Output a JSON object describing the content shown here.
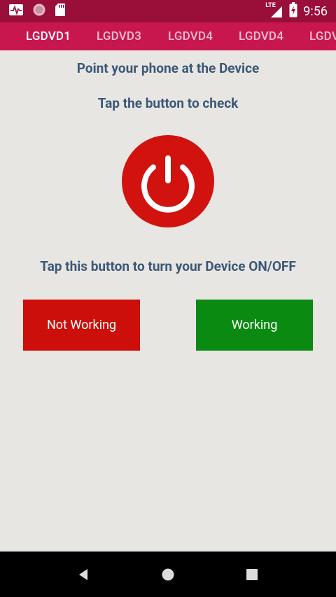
{
  "status_bar": {
    "time": "9:56",
    "network": "LTE",
    "icons": [
      "activity-icon",
      "record-icon",
      "sd-card-icon",
      "signal-icon",
      "battery-charging-icon"
    ]
  },
  "tabs": [
    {
      "label": "LGDVD1",
      "active": true
    },
    {
      "label": "LGDVD3",
      "active": false
    },
    {
      "label": "LGDVD4",
      "active": false
    },
    {
      "label": "LGDVD4",
      "active": false
    },
    {
      "label": "LGDVD",
      "active": false
    }
  ],
  "main": {
    "instruction_point": "Point your phone at the Device",
    "instruction_tap": "Tap the button to check",
    "power_icon": "power-icon",
    "instruction_toggle": "Tap this button to turn your Device ON/OFF",
    "not_working_label": "Not Working",
    "working_label": "Working"
  },
  "colors": {
    "status_bar": "#9a0e3a",
    "tab_bar": "#c8174f",
    "background": "#e8e6e3",
    "heading_text": "#3c5877",
    "power_button": "#d1120e",
    "not_working": "#cc0f0a",
    "working": "#0b8a12",
    "nav_bar": "#000000"
  },
  "nav_bar": {
    "buttons": [
      "back-icon",
      "home-icon",
      "recents-icon"
    ]
  }
}
